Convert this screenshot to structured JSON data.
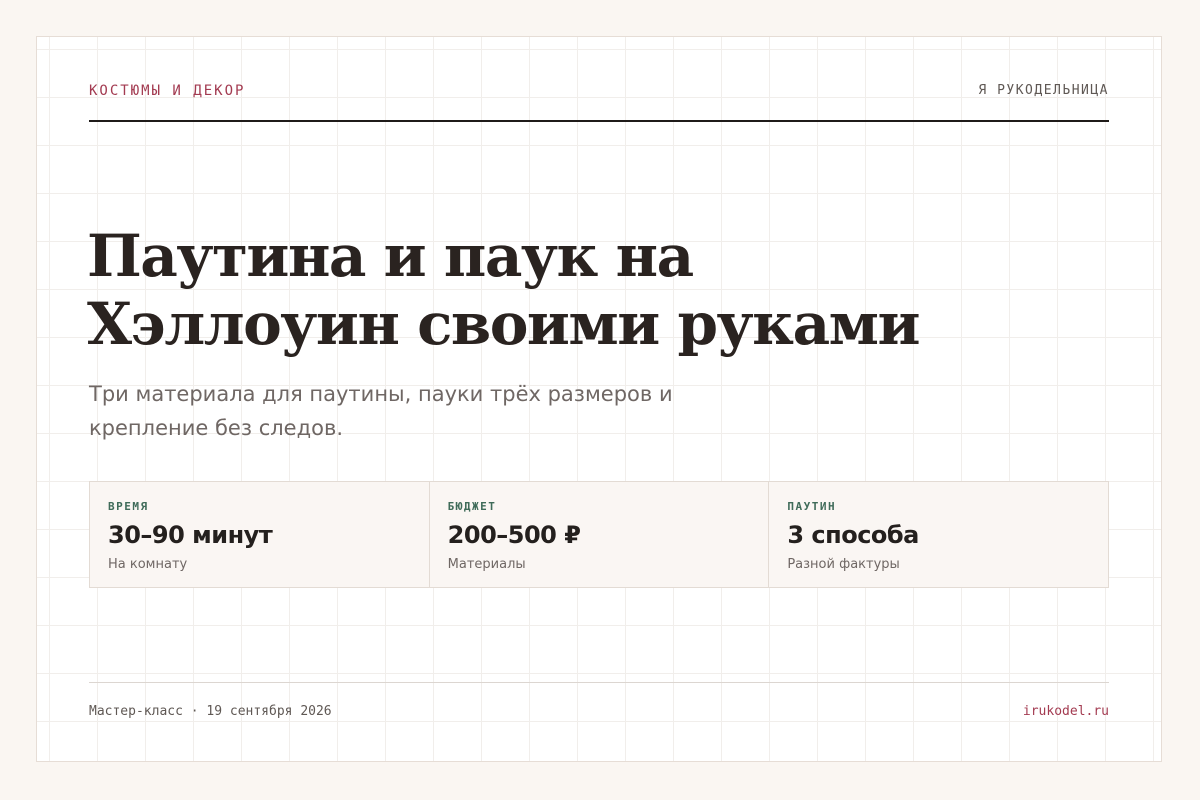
{
  "header": {
    "category": "КОСТЮМЫ И ДЕКОР",
    "brand": "Я РУКОДЕЛЬНИЦА"
  },
  "hero": {
    "title": "Паутина и паук на Хэллоуин своими руками",
    "subtitle": "Три материала для паутины, пауки трёх размеров и крепление без следов."
  },
  "stats": [
    {
      "label": "ВРЕМЯ",
      "value": "30–90 минут",
      "note": "На комнату"
    },
    {
      "label": "БЮДЖЕТ",
      "value": "200–500 ₽",
      "note": "Материалы"
    },
    {
      "label": "ПАУТИН",
      "value": "3 способа",
      "note": "Разной фактуры"
    }
  ],
  "footer": {
    "meta": "Мастер-класс · 19 сентября 2026",
    "site": "irukodel.ru"
  },
  "colors": {
    "accent": "#a33b51",
    "label_green": "#3f6b59",
    "text_dark": "#2a2320",
    "background": "#faf6f2"
  }
}
